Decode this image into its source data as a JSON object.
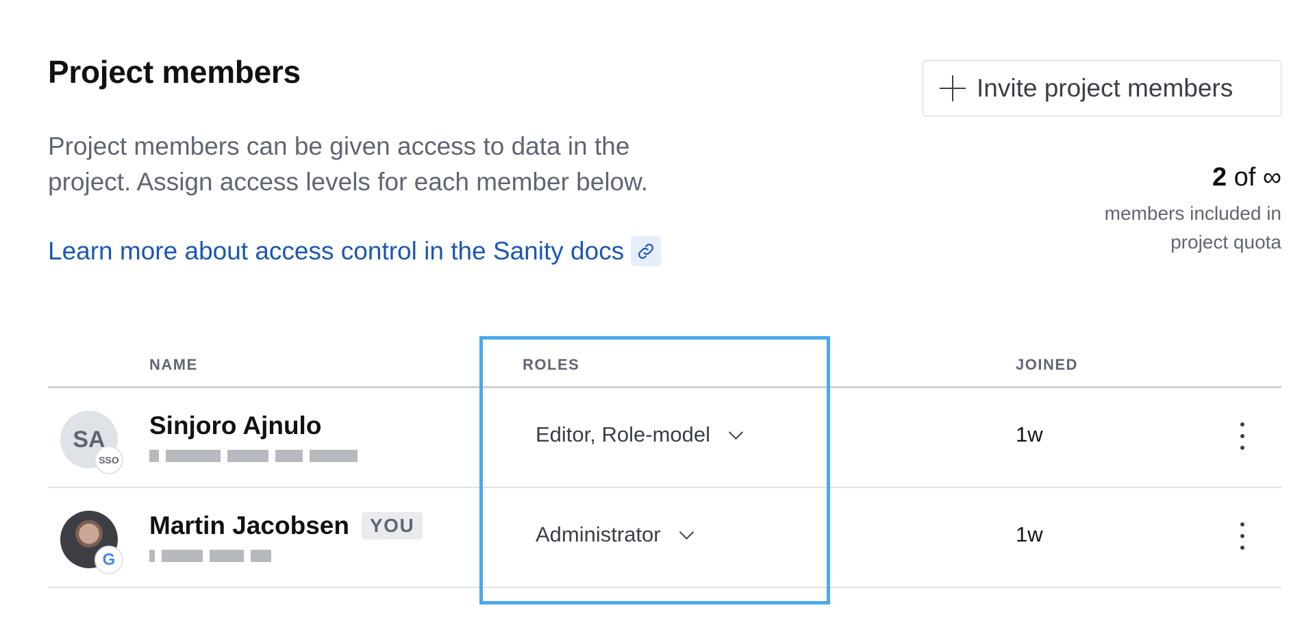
{
  "header": {
    "title": "Project members",
    "description": "Project members can be given access to data in the project. Assign access levels for each member below.",
    "docs_link": "Learn more about access control in the Sanity docs",
    "invite_button": "Invite project members"
  },
  "quota": {
    "count": "2",
    "of": "of",
    "limit": "∞",
    "caption": "members included in project quota"
  },
  "table": {
    "columns": {
      "name": "NAME",
      "roles": "ROLES",
      "joined": "JOINED"
    },
    "rows": [
      {
        "initials": "SA",
        "badge": "SSO",
        "name": "Sinjoro Ajnulo",
        "you": "",
        "role": "Editor, Role-model",
        "joined": "1w"
      },
      {
        "initials": "",
        "badge": "G",
        "name": "Martin Jacobsen",
        "you": "YOU",
        "role": "Administrator",
        "joined": "1w"
      }
    ]
  },
  "icons": {
    "invite": "plus-icon",
    "docs": "link-icon",
    "role_dropdown": "chevron-down-icon",
    "row_menu": "kebab-menu-icon"
  },
  "colors": {
    "link": "#1b57b5",
    "highlight": "#4aa8ef"
  }
}
